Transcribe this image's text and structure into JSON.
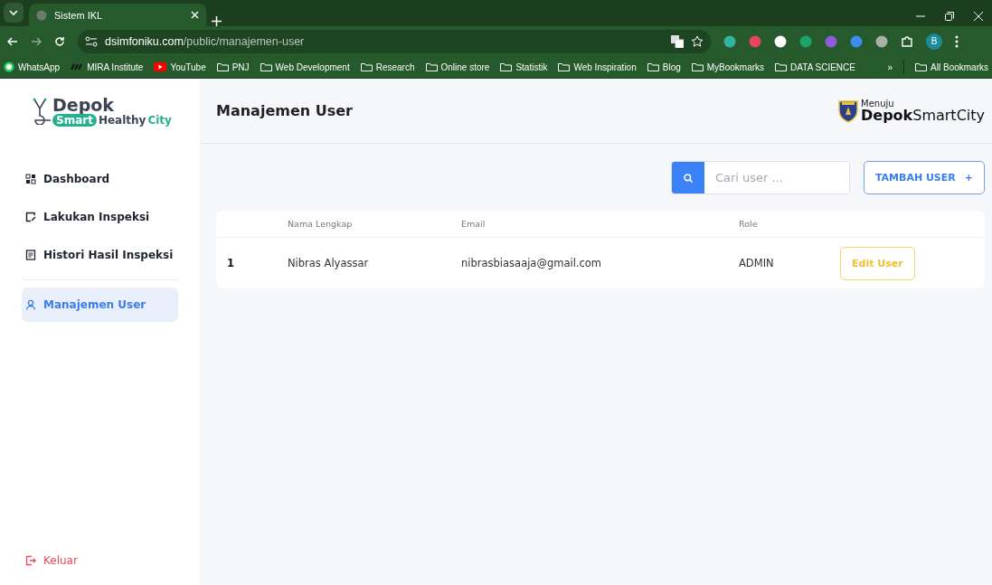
{
  "browser": {
    "tab_title": "Sistem IKL",
    "url_domain": "dsimfoniku.com",
    "url_path": "/public/manajemen-user",
    "profile": "B",
    "bookmarks": [
      {
        "label": "WhatsApp",
        "kind": "whatsapp"
      },
      {
        "label": "MIRA Institute",
        "kind": "mira"
      },
      {
        "label": "YouTube",
        "kind": "youtube"
      },
      {
        "label": "PNJ",
        "kind": "folder"
      },
      {
        "label": "Web Development",
        "kind": "folder"
      },
      {
        "label": "Research",
        "kind": "folder"
      },
      {
        "label": "Online store",
        "kind": "folder"
      },
      {
        "label": "Statistik",
        "kind": "folder"
      },
      {
        "label": "Web Inspiration",
        "kind": "folder"
      },
      {
        "label": "Blog",
        "kind": "folder"
      },
      {
        "label": "MyBookmarks",
        "kind": "folder"
      },
      {
        "label": "DATA SCIENCE",
        "kind": "folder"
      }
    ],
    "more": "»",
    "all_bookmarks": "All Bookmarks"
  },
  "sidebar": {
    "logo": {
      "top": "Depok",
      "badge": "Smart",
      "middle": "Healthy",
      "end": "City"
    },
    "nav": [
      {
        "label": "Dashboard",
        "kind": "grid",
        "selected": false
      },
      {
        "label": "Lakukan Inspeksi",
        "kind": "edit",
        "selected": false
      },
      {
        "label": "Histori Hasil Inspeksi",
        "kind": "doc",
        "selected": false
      },
      {
        "label": "Manajemen User",
        "kind": "user",
        "selected": true
      }
    ],
    "logout": "Keluar"
  },
  "header": {
    "title": "Manajemen User",
    "brand": {
      "small": "Menuju",
      "bold": "Depok",
      "rest": "SmartCity"
    }
  },
  "toolbar": {
    "search": {
      "placeholder": "Cari user ..."
    },
    "add_button": {
      "label": "TAMBAH USER",
      "icon": "+"
    }
  },
  "table": {
    "columns": [
      "Nama Lengkap",
      "Email",
      "Role"
    ],
    "rows": [
      {
        "no": "1",
        "name": "Nibras Alyassar",
        "email": "nibrasbiasaaja@gmail.com",
        "role": "ADMIN",
        "action": "Edit User"
      }
    ]
  }
}
